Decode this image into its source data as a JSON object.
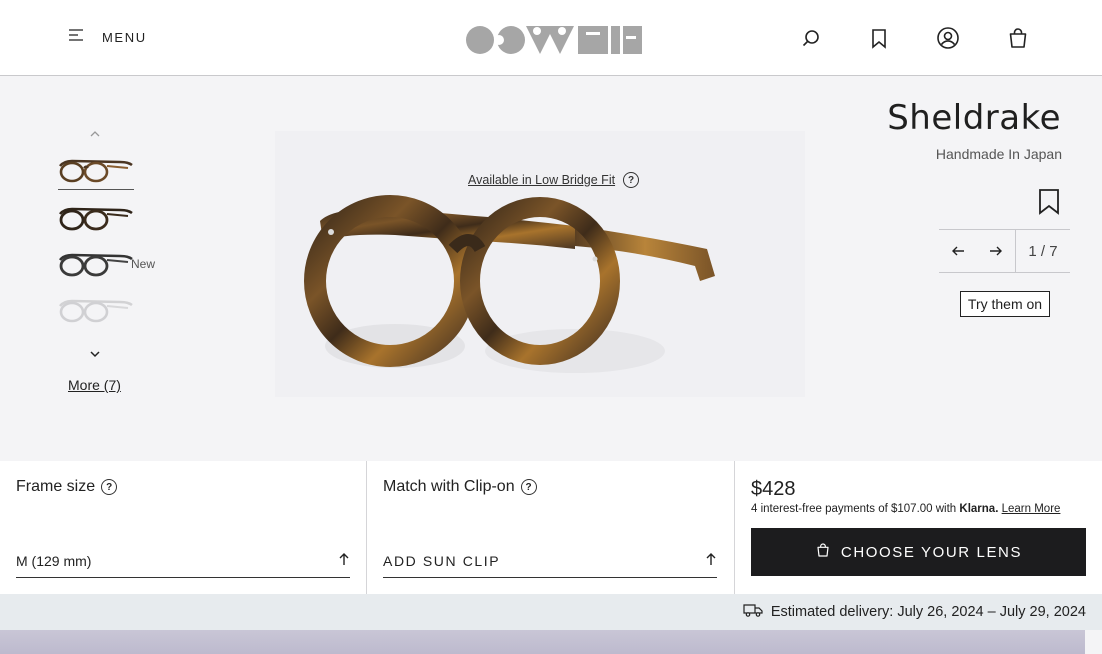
{
  "header": {
    "menu_label": "MENU",
    "icons": [
      "search-icon",
      "bookmark-icon",
      "account-icon",
      "shopping-bag-icon"
    ]
  },
  "gallery": {
    "thumbnails": [
      {
        "name": "thumbnail-tortoise",
        "active": true,
        "badge": ""
      },
      {
        "name": "thumbnail-dark-tortoise",
        "active": false,
        "badge": ""
      },
      {
        "name": "thumbnail-black",
        "active": false,
        "badge": "New"
      },
      {
        "name": "thumbnail-clear",
        "active": false,
        "badge": ""
      }
    ],
    "more_label": "More (7)",
    "low_bridge_label": "Available in Low Bridge Fit",
    "help_glyph": "?"
  },
  "product": {
    "title": "Sheldrake",
    "subtitle": "Handmade In Japan",
    "pager": "1 / 7",
    "try_on_label": "Try them on"
  },
  "config": {
    "frame_size": {
      "title": "Frame size",
      "value": "M (129 mm)"
    },
    "clip_on": {
      "title": "Match with Clip-on",
      "value": "ADD SUN CLIP"
    },
    "purchase": {
      "price": "$428",
      "klarna_text": "4 interest-free payments of $107.00 with",
      "klarna_brand": "Klarna.",
      "klarna_link": "Learn More",
      "cta_label": "CHOOSE YOUR LENS"
    }
  },
  "delivery": {
    "text": "Estimated delivery: July 26, 2024 – July 29, 2024"
  },
  "colors": {
    "frame_brown": "#4a3522",
    "frame_amber": "#a8732c",
    "cta_bg": "#1c1c1e"
  }
}
